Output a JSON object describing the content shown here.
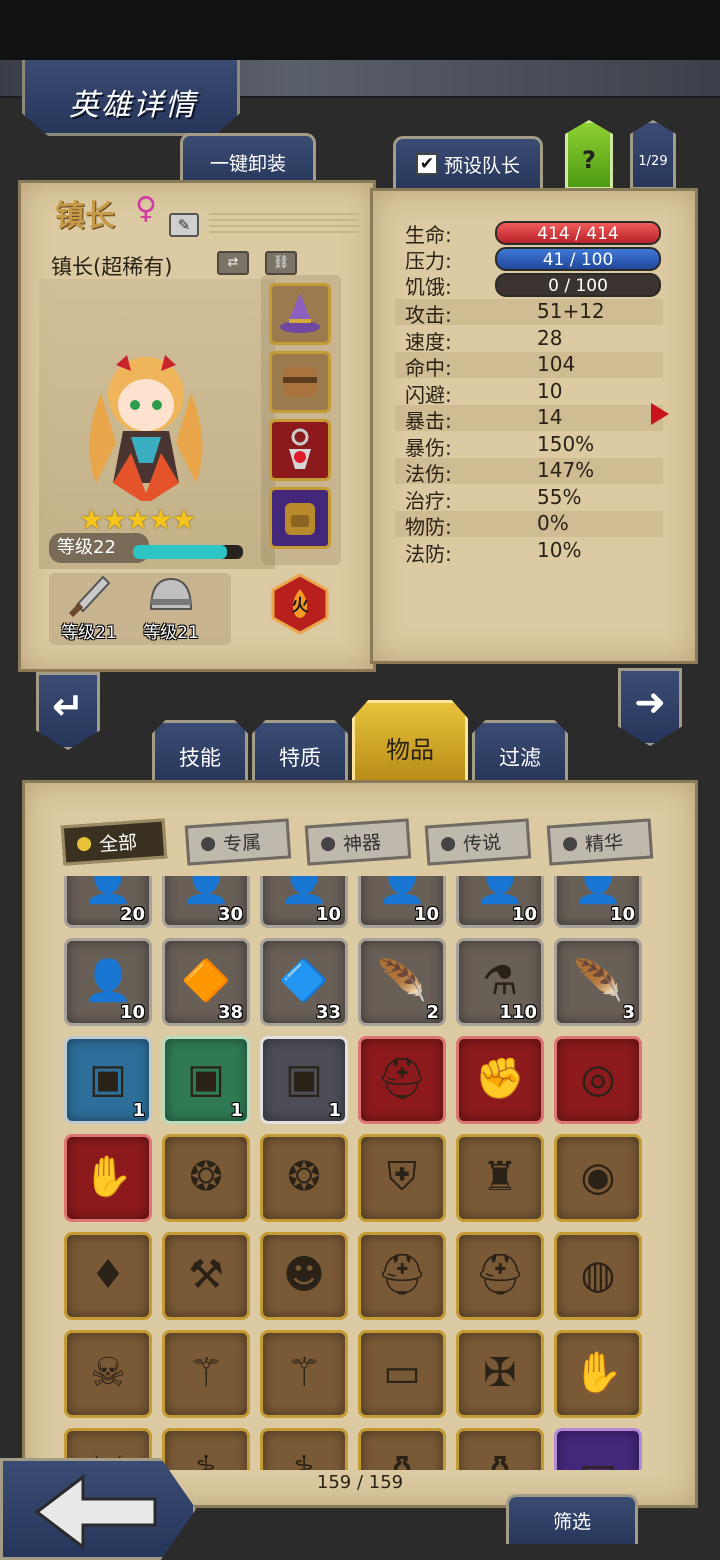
{
  "header": {
    "title": "英雄详情"
  },
  "toolbar": {
    "unequip_label": "一键卸装",
    "leader_label": "预设队长",
    "leader_checked": "✔",
    "help_label": "?",
    "page_count": "1/29"
  },
  "hero": {
    "name": "镇长",
    "gender_symbol": "♀",
    "class_label": "镇长(超稀有)",
    "stars": "★★★★★",
    "level_label": "等级22",
    "xp_fraction": 0.85,
    "element_label": "火",
    "equipment_slots": [
      "hat-icon",
      "chest-icon",
      "amulet-icon",
      "backpack-icon"
    ],
    "gear": [
      {
        "icon": "sword-icon",
        "level_label": "等级21"
      },
      {
        "icon": "helmet-icon",
        "level_label": "等级21"
      }
    ]
  },
  "stats": {
    "hp": {
      "label": "生命:",
      "value": "414 / 414",
      "fraction": 1.0
    },
    "stress": {
      "label": "压力:",
      "value": "41 / 100",
      "fraction": 0.41
    },
    "hunger": {
      "label": "饥饿:",
      "value": "0 / 100",
      "fraction": 0.0
    },
    "rows": [
      {
        "label": "攻击:",
        "value": "51+12"
      },
      {
        "label": "速度:",
        "value": "28"
      },
      {
        "label": "命中:",
        "value": "104"
      },
      {
        "label": "闪避:",
        "value": "10"
      },
      {
        "label": "暴击:",
        "value": "14"
      },
      {
        "label": "暴伤:",
        "value": "150%"
      },
      {
        "label": "法伤:",
        "value": "147%"
      },
      {
        "label": "治疗:",
        "value": "55%"
      },
      {
        "label": "物防:",
        "value": "0%"
      },
      {
        "label": "法防:",
        "value": "10%"
      }
    ]
  },
  "tabs": [
    "技能",
    "特质",
    "物品",
    "过滤"
  ],
  "active_tab": "物品",
  "filters": [
    "全部",
    "专属",
    "神器",
    "传说",
    "精华"
  ],
  "active_filter": "全部",
  "inventory": {
    "counter": "159 / 159",
    "rows": [
      [
        {
          "icon": "hero-portrait-icon",
          "qty": "20",
          "style": "gray"
        },
        {
          "icon": "hero-portrait-icon",
          "qty": "30",
          "style": "gray"
        },
        {
          "icon": "hero-portrait-icon",
          "qty": "10",
          "style": "gray"
        },
        {
          "icon": "hero-portrait-icon",
          "qty": "10",
          "style": "gray"
        },
        {
          "icon": "hero-portrait-icon",
          "qty": "10",
          "style": "gray"
        },
        {
          "icon": "hero-portrait-icon",
          "qty": "10",
          "style": "gray"
        }
      ],
      [
        {
          "icon": "hero-portrait-icon",
          "qty": "10",
          "style": "gray"
        },
        {
          "icon": "orange-gem-icon",
          "qty": "38",
          "style": "gray"
        },
        {
          "icon": "teal-gem-icon",
          "qty": "33",
          "style": "gray"
        },
        {
          "icon": "feather-quill-icon",
          "qty": "2",
          "style": "gray"
        },
        {
          "icon": "potion-icon",
          "qty": "110",
          "style": "gray"
        },
        {
          "icon": "white-feather-icon",
          "qty": "3",
          "style": "gray"
        }
      ],
      [
        {
          "icon": "chest-icon",
          "qty": "1",
          "style": "teal"
        },
        {
          "icon": "chest-icon",
          "qty": "1",
          "style": "green"
        },
        {
          "icon": "chest-icon",
          "qty": "1",
          "style": "silver"
        },
        {
          "icon": "spiked-helm-icon",
          "qty": "",
          "style": "red"
        },
        {
          "icon": "gauntlet-icon",
          "qty": "",
          "style": "red"
        },
        {
          "icon": "ring-icon",
          "qty": "",
          "style": "red"
        }
      ],
      [
        {
          "icon": "claw-gauntlet-icon",
          "qty": "",
          "style": "red"
        },
        {
          "icon": "winged-amulet-icon",
          "qty": "",
          "style": ""
        },
        {
          "icon": "winged-amulet-icon",
          "qty": "",
          "style": ""
        },
        {
          "icon": "shield-icon",
          "qty": "",
          "style": ""
        },
        {
          "icon": "hood-icon",
          "qty": "",
          "style": ""
        },
        {
          "icon": "emerald-ring-icon",
          "qty": "",
          "style": ""
        }
      ],
      [
        {
          "icon": "crystal-helm-icon",
          "qty": "",
          "style": ""
        },
        {
          "icon": "heart-axe-icon",
          "qty": "",
          "style": ""
        },
        {
          "icon": "voodoo-doll-icon",
          "qty": "",
          "style": ""
        },
        {
          "icon": "blue-helm-icon",
          "qty": "",
          "style": ""
        },
        {
          "icon": "blue-helm-icon",
          "qty": "",
          "style": ""
        },
        {
          "icon": "dragon-ring-icon",
          "qty": "",
          "style": ""
        }
      ],
      [
        {
          "icon": "skull-staff-icon",
          "qty": "",
          "style": ""
        },
        {
          "icon": "wand-icon",
          "qty": "",
          "style": ""
        },
        {
          "icon": "wand-icon",
          "qty": "",
          "style": ""
        },
        {
          "icon": "red-belt-icon",
          "qty": "",
          "style": ""
        },
        {
          "icon": "cross-armor-icon",
          "qty": "",
          "style": ""
        },
        {
          "icon": "claw-gauntlet-icon",
          "qty": "",
          "style": ""
        }
      ],
      [
        {
          "icon": "red-sword-icon",
          "qty": "",
          "style": ""
        },
        {
          "icon": "scepter-icon",
          "qty": "",
          "style": ""
        },
        {
          "icon": "scepter-icon",
          "qty": "",
          "style": ""
        },
        {
          "icon": "bottle-icon",
          "qty": "",
          "style": ""
        },
        {
          "icon": "bottle-icon",
          "qty": "",
          "style": ""
        },
        {
          "icon": "red-belt-icon",
          "qty": "",
          "style": "purple"
        }
      ]
    ]
  },
  "bottom": {
    "filter_label": "筛选"
  }
}
